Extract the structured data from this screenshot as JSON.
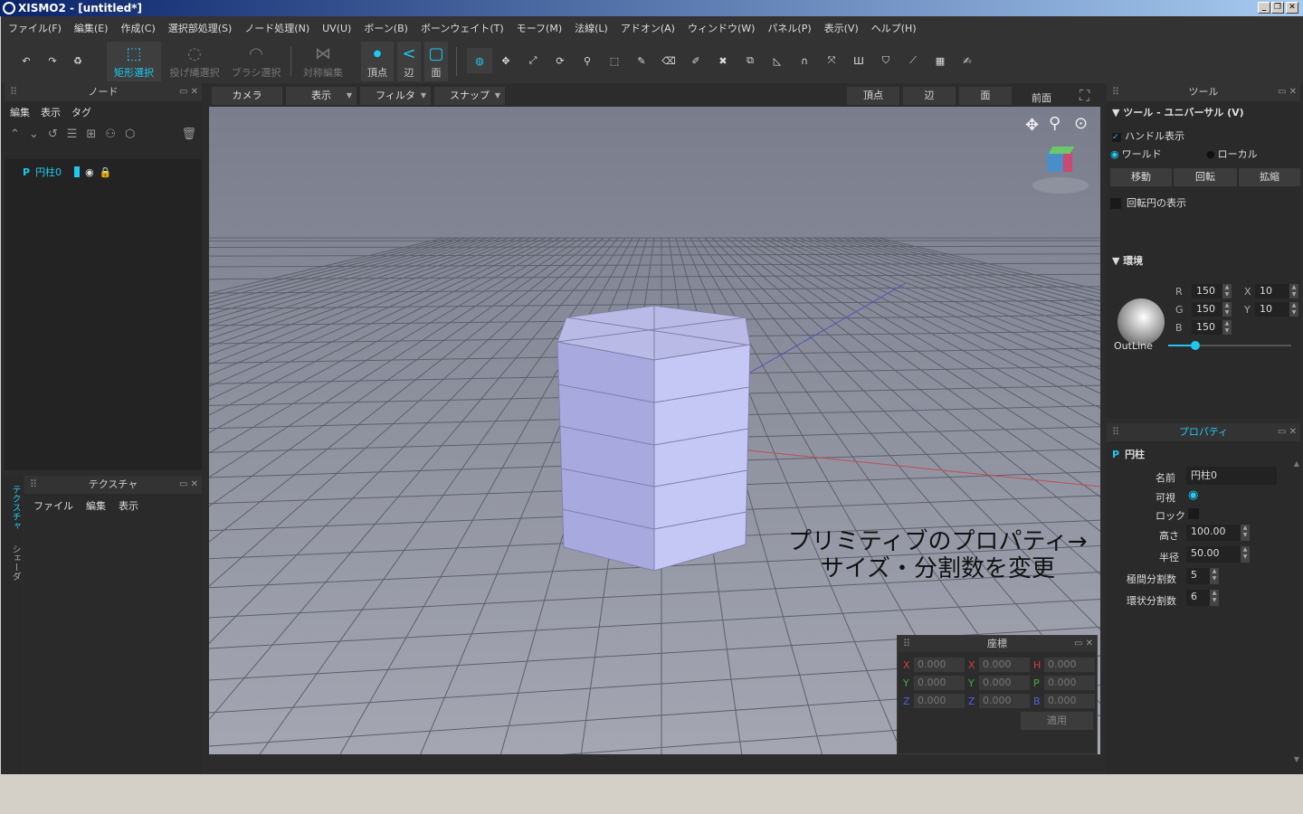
{
  "window": {
    "title": "XISMO2 - [untitled*]"
  },
  "menu": [
    "ファイル(F)",
    "編集(E)",
    "作成(C)",
    "選択部処理(S)",
    "ノード処理(N)",
    "UV(U)",
    "ボーン(B)",
    "ボーンウェイト(T)",
    "モーフ(M)",
    "法線(L)",
    "アドオン(A)",
    "ウィンドウ(W)",
    "パネル(P)",
    "表示(V)",
    "ヘルプ(H)"
  ],
  "toolbar": {
    "rect_select": "矩形選択",
    "lasso_select": "投げ縄選択",
    "brush_select": "ブラシ選択",
    "symmetry_edit": "対称編集",
    "vertex": "頂点",
    "edge": "辺",
    "face": "面"
  },
  "node_panel": {
    "title": "ノード",
    "menu": [
      "編集",
      "表示",
      "タグ"
    ],
    "item": "円柱0"
  },
  "texture_panel": {
    "title": "テクスチャ",
    "menu": [
      "ファイル",
      "編集",
      "表示"
    ],
    "side_tabs": [
      "テクスチャ",
      "シェーダ"
    ]
  },
  "viewport": {
    "buttons": [
      "カメラ",
      "表示",
      "フィルタ",
      "スナップ"
    ],
    "mode_buttons": [
      "頂点",
      "辺",
      "面"
    ],
    "view_name": "前面",
    "annotation_line1": "プリミティブのプロパティ→",
    "annotation_line2": "サイズ・分割数を変更"
  },
  "coords_panel": {
    "title": "座標",
    "rows": [
      {
        "a": "X",
        "av": "0.000",
        "b": "X",
        "bv": "0.000",
        "c": "H",
        "cv": "0.000"
      },
      {
        "a": "Y",
        "av": "0.000",
        "b": "Y",
        "bv": "0.000",
        "c": "P",
        "cv": "0.000"
      },
      {
        "a": "Z",
        "av": "0.000",
        "b": "Z",
        "bv": "0.000",
        "c": "B",
        "cv": "0.000"
      }
    ],
    "apply": "適用"
  },
  "tool_panel": {
    "title": "ツール",
    "section": "ツール - ユニバーサル (V)",
    "handle_display": "ハンドル表示",
    "world": "ワールド",
    "local": "ローカル",
    "move": "移動",
    "rotate": "回転",
    "scale": "拡縮",
    "rotation_circle": "回転円の表示",
    "env_section": "環境",
    "r_label": "R",
    "r_value": "150",
    "g_label": "G",
    "g_value": "150",
    "b_label": "B",
    "b_value": "150",
    "x_label": "X",
    "x_value": "10",
    "y_label": "Y",
    "y_value": "10",
    "outline_label": "OutLine",
    "outline_level": 0.22
  },
  "property_panel": {
    "title": "プロパティ",
    "object": "円柱",
    "name_label": "名前",
    "name_value": "円柱0",
    "visible_label": "可視",
    "lock_label": "ロック",
    "height_label": "高さ",
    "height_value": "100.00",
    "radius_label": "半径",
    "radius_value": "50.00",
    "vdiv_label": "極間分割数",
    "vdiv_value": "5",
    "rdiv_label": "環状分割数",
    "rdiv_value": "6"
  },
  "colors": {
    "accent": "#1ec8f0",
    "bg": "#2c2c2c",
    "viewport_top": "#7a7d8c",
    "viewport_bottom": "#a4a6b2"
  }
}
